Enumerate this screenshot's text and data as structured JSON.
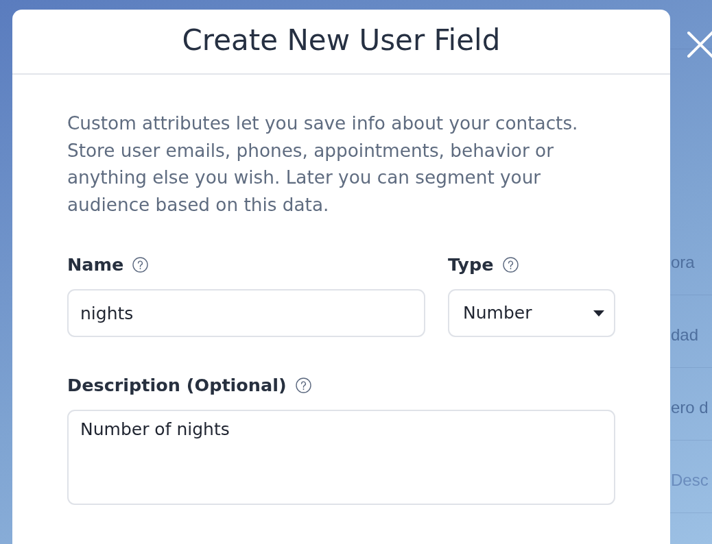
{
  "background_table": {
    "rows": [
      {
        "kind": "text",
        "text": "ora"
      },
      {
        "kind": "text",
        "text": "dad"
      },
      {
        "kind": "text",
        "text": "ero d"
      },
      {
        "kind": "field",
        "placeholder": "Desc"
      }
    ]
  },
  "modal": {
    "title": "Create New User Field",
    "intro": "Custom attributes let you save info about your contacts. Store user emails, phones, appointments, behavior or anything else you wish. Later you can segment your audience based on this data.",
    "fields": [
      {
        "kind": "input",
        "label": "Name",
        "value": "nights"
      },
      {
        "kind": "select",
        "label": "Type",
        "value": "Number"
      },
      {
        "kind": "textarea",
        "label": "Description (Optional)",
        "value": "Number of nights"
      }
    ]
  }
}
